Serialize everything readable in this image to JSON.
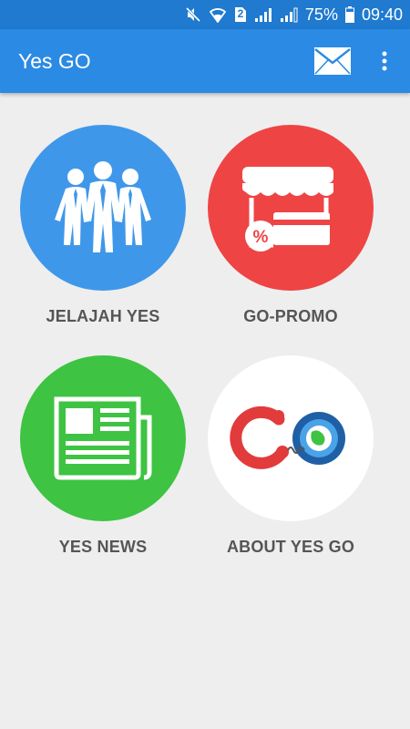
{
  "status_bar": {
    "battery": "75%",
    "time": "09:40",
    "sim_slot": "2",
    "icons": [
      "mute-icon",
      "wifi-icon",
      "sim-icon",
      "signal-icon",
      "signal-icon",
      "battery-icon"
    ]
  },
  "app_bar": {
    "title": "Yes GO",
    "actions": [
      "mail-icon",
      "more-vert-icon"
    ]
  },
  "menu": {
    "items": [
      {
        "label": "JELAJAH YES",
        "icon": "people-icon",
        "color": "#3f97ea"
      },
      {
        "label": "GO-PROMO",
        "icon": "store-promo-icon",
        "color": "#ef4444"
      },
      {
        "label": "YES NEWS",
        "icon": "newspaper-icon",
        "color": "#3ec342"
      },
      {
        "label": "ABOUT YES GO",
        "icon": "go-logo-icon",
        "color": "#ffffff"
      }
    ]
  },
  "colors": {
    "status_bar": "#1f7ad0",
    "app_bar": "#2b8ae3",
    "background": "#eeeeee",
    "label_text": "#555555"
  }
}
